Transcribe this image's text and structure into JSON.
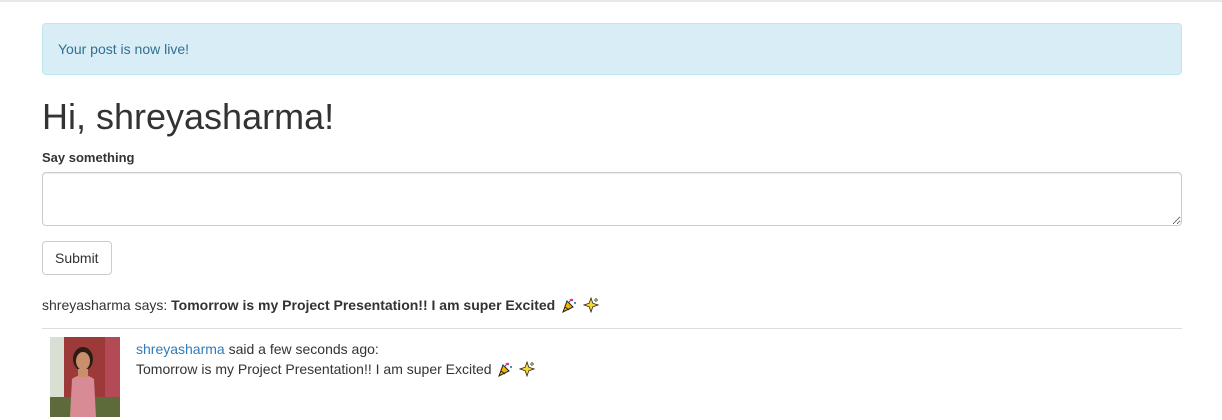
{
  "alert": {
    "message": "Your post is now live!"
  },
  "greeting": "Hi, shreyasharma!",
  "form": {
    "label": "Say something",
    "textarea_value": "",
    "submit_label": "Submit"
  },
  "latest": {
    "username": "shreyasharma",
    "says_label": "says:",
    "message": "Tomorrow is my Project Presentation!! I am super Excited",
    "emoji_icons": [
      "party-popper-icon",
      "sparkles-icon"
    ]
  },
  "posts": [
    {
      "username": "shreyasharma",
      "time_text": "said a few seconds ago:",
      "body": "Tomorrow is my Project Presentation!! I am super Excited",
      "emoji_icons": [
        "party-popper-icon",
        "sparkles-icon"
      ],
      "avatar_icon": "user-avatar"
    }
  ],
  "colors": {
    "alert_bg": "#d9edf7",
    "alert_text": "#31708f",
    "link": "#337ab7"
  }
}
